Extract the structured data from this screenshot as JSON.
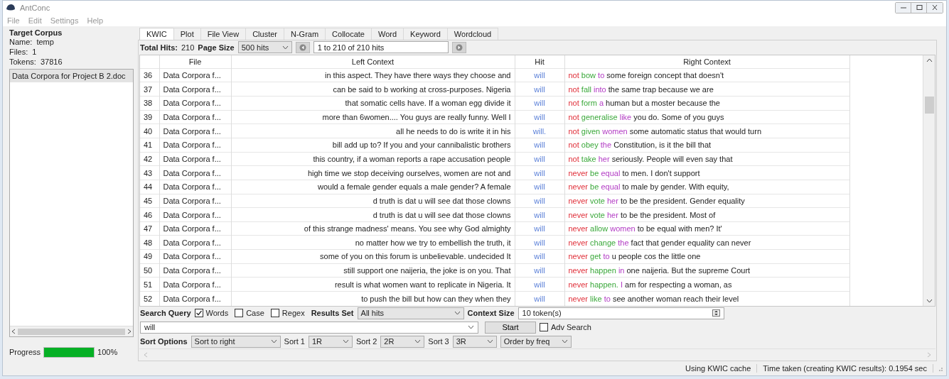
{
  "window": {
    "title": "AntConc"
  },
  "menu": [
    "File",
    "Edit",
    "Settings",
    "Help"
  ],
  "corpus": {
    "heading": "Target Corpus",
    "name_label": "Name:",
    "name": "temp",
    "files_label": "Files:",
    "files": "1",
    "tokens_label": "Tokens:",
    "tokens": "37816",
    "file_list": [
      {
        "name": "Data Corpora for Project B 2.doc",
        "selected": true
      }
    ]
  },
  "progress": {
    "label": "Progress",
    "level": 1,
    "reading": "100%"
  },
  "tabs": [
    {
      "label": "KWIC",
      "selected": true
    },
    {
      "label": "Plot",
      "selected": false
    },
    {
      "label": "File View",
      "selected": false
    },
    {
      "label": "Cluster",
      "selected": false
    },
    {
      "label": "N-Gram",
      "selected": false
    },
    {
      "label": "Collocate",
      "selected": false
    },
    {
      "label": "Word",
      "selected": false
    },
    {
      "label": "Keyword",
      "selected": false
    },
    {
      "label": "Wordcloud",
      "selected": false
    }
  ],
  "hits_bar": {
    "total_label": "Total Hits:",
    "total": "210",
    "page_size_label": "Page Size",
    "page_size": "500 hits",
    "range": "1 to 210 of 210 hits"
  },
  "table": {
    "columns": [
      "File",
      "Left Context",
      "Hit",
      "Right Context"
    ],
    "rows": [
      {
        "n": "36",
        "file": "Data Corpora f...",
        "left": "in this aspect. They have there ways they choose and",
        "hit": "will",
        "r1": "not",
        "r2": "bow",
        "r3": "to",
        "rest": "some foreign concept that doesn't"
      },
      {
        "n": "37",
        "file": "Data Corpora f...",
        "left": "can be said to b working at cross-purposes. Nigeria",
        "hit": "will",
        "r1": "not",
        "r2": "fall",
        "r3": "into",
        "rest": "the same trap because we are"
      },
      {
        "n": "38",
        "file": "Data Corpora f...",
        "left": "that somatic cells have. If a woman egg divide it",
        "hit": "will",
        "r1": "not",
        "r2": "form",
        "r3": "a",
        "rest": "human but a moster because the"
      },
      {
        "n": "39",
        "file": "Data Corpora f...",
        "left": "more than 6women.... You guys are really funny. Well I",
        "hit": "will",
        "r1": "not",
        "r2": "generalise",
        "r3": "like",
        "rest": "you do. Some of you guys"
      },
      {
        "n": "40",
        "file": "Data Corpora f...",
        "left": "all he needs to do is write it in his",
        "hit": "will.",
        "r1": "not",
        "r2": "given",
        "r3": "women",
        "rest": "some automatic status that would turn"
      },
      {
        "n": "41",
        "file": "Data Corpora f...",
        "left": "bill add up to? If you and your cannibalistic brothers",
        "hit": "will",
        "r1": "not",
        "r2": "obey",
        "r3": "the",
        "rest": "Constitution, is it the bill that"
      },
      {
        "n": "42",
        "file": "Data Corpora f...",
        "left": "this country, if a woman reports a rape accusation people",
        "hit": "will",
        "r1": "not",
        "r2": "take",
        "r3": "her",
        "rest": "seriously. People will even say that"
      },
      {
        "n": "43",
        "file": "Data Corpora f...",
        "left": "high time we stop deceiving ourselves, women are not and",
        "hit": "will",
        "r1": "never",
        "r2": "be",
        "r3": "equal",
        "rest": "to men. I don't support"
      },
      {
        "n": "44",
        "file": "Data Corpora f...",
        "left": "would a female gender equals a male gender? A female",
        "hit": "will",
        "r1": "never",
        "r2": "be",
        "r3": "equal",
        "rest": "to male by gender. With equity,"
      },
      {
        "n": "45",
        "file": "Data Corpora f...",
        "left": "d truth is dat u will see dat those clowns",
        "hit": "will",
        "r1": "never",
        "r2": "vote",
        "r3": "her",
        "rest": "to be the president. Gender equality"
      },
      {
        "n": "46",
        "file": "Data Corpora f...",
        "left": "d truth is dat u will see dat those clowns",
        "hit": "will",
        "r1": "never",
        "r2": "vote",
        "r3": "her",
        "rest": "to be the president. Most of"
      },
      {
        "n": "47",
        "file": "Data Corpora f...",
        "left": "of this strange madness' means. You see why God almighty",
        "hit": "will",
        "r1": "never",
        "r2": "allow",
        "r3": "women",
        "rest": "to be equal with men? It'"
      },
      {
        "n": "48",
        "file": "Data Corpora f...",
        "left": "no matter how we try to embellish the truth, it",
        "hit": "will",
        "r1": "never",
        "r2": "change",
        "r3": "the",
        "rest": "fact that gender equality can never"
      },
      {
        "n": "49",
        "file": "Data Corpora f...",
        "left": "some of you on this forum is unbelievable. undecided It",
        "hit": "will",
        "r1": "never",
        "r2": "get",
        "r3": "to",
        "rest": "u people cos the little one"
      },
      {
        "n": "50",
        "file": "Data Corpora f...",
        "left": "still support one naijeria, the joke is on you. That",
        "hit": "will",
        "r1": "never",
        "r2": "happen",
        "r3": "in",
        "rest": "one naijeria. But the supreme Court"
      },
      {
        "n": "51",
        "file": "Data Corpora f...",
        "left": "result is what women want to replicate in Nigeria. It",
        "hit": "will",
        "r1": "never",
        "r2": "happen.",
        "r3": "I",
        "rest": "am for respecting a woman, as"
      },
      {
        "n": "52",
        "file": "Data Corpora f...",
        "left": "to push the bill but how can they when they",
        "hit": "will",
        "r1": "never",
        "r2": "like",
        "r3": "to",
        "rest": "see another woman reach their level"
      }
    ]
  },
  "search": {
    "label": "Search Query",
    "options": [
      {
        "label": "Words",
        "checked": true
      },
      {
        "label": "Case",
        "checked": false
      },
      {
        "label": "Regex",
        "checked": false
      }
    ],
    "results_set_label": "Results Set",
    "results_set": "All hits",
    "context_size_label": "Context Size",
    "context_size": "10 token(s)",
    "query": "will",
    "start": "Start",
    "adv_search": {
      "label": "Adv Search",
      "checked": false
    }
  },
  "sort": {
    "label": "Sort Options",
    "mode": "Sort to right",
    "levels": [
      {
        "label": "Sort 1",
        "value": "1R"
      },
      {
        "label": "Sort 2",
        "value": "2R"
      },
      {
        "label": "Sort 3",
        "value": "3R"
      }
    ],
    "order": "Order by freq"
  },
  "status_bar": [
    "Using KWIC cache",
    "Time taken (creating KWIC results): 0.1954 sec"
  ]
}
